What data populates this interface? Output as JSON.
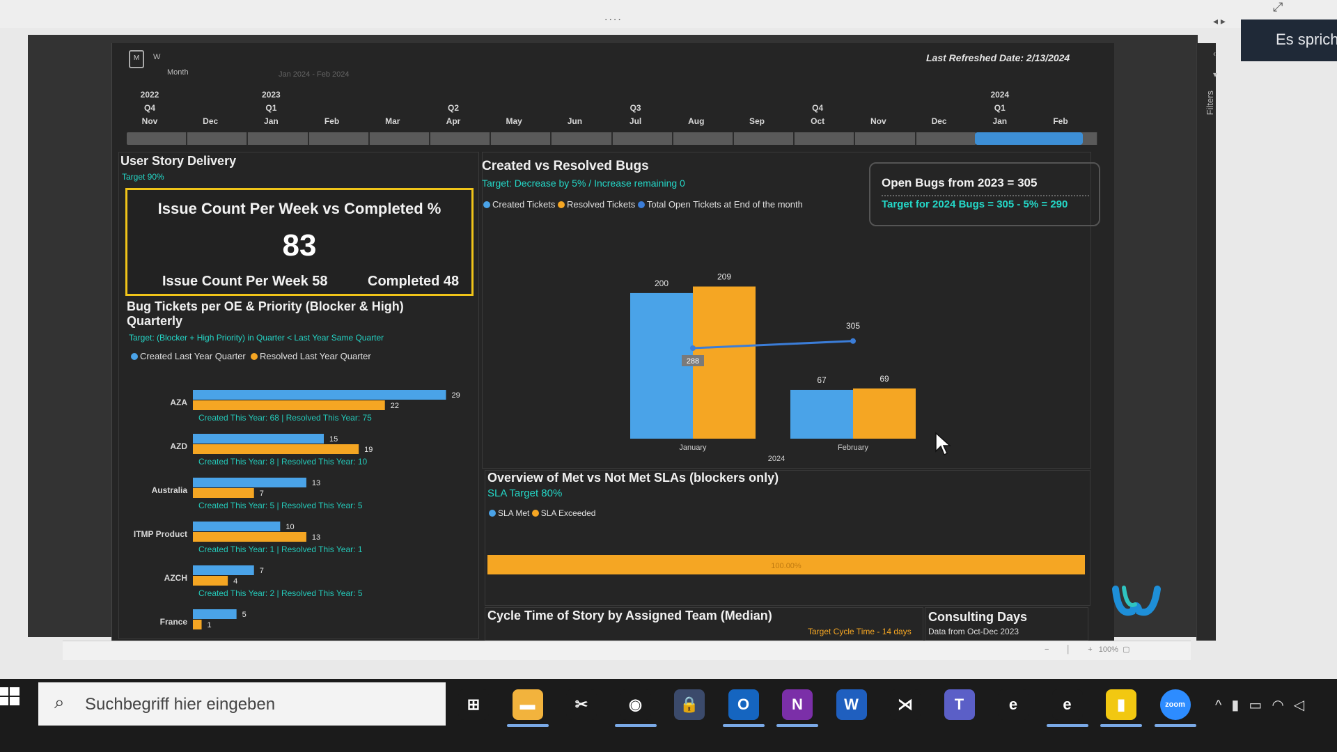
{
  "window": {
    "dots": "....",
    "speaking_text": "Es sprich"
  },
  "header": {
    "logo_letter": "M",
    "w_label": "W",
    "month_label": "Month",
    "range_label": "Jan 2024 - Feb 2024",
    "last_refreshed": "Last Refreshed Date: 2/13/2024"
  },
  "timeline": {
    "years": [
      {
        "label": "2022"
      },
      {
        "label": "2023"
      },
      {
        "label": "2024"
      }
    ],
    "quarters": [
      "Q4",
      "Q1",
      "Q2",
      "Q3",
      "Q4",
      "Q1"
    ],
    "months": [
      "Nov",
      "Dec",
      "Jan",
      "Feb",
      "Mar",
      "Apr",
      "May",
      "Jun",
      "Jul",
      "Aug",
      "Sep",
      "Oct",
      "Nov",
      "Dec",
      "Jan",
      "Feb"
    ],
    "selected_months": [
      "Jan",
      "Feb"
    ]
  },
  "story_delivery": {
    "title": "User Story Delivery",
    "target": "Target 90%",
    "card_title": "Issue Count Per Week vs Completed %",
    "value": "83",
    "left_label": "Issue Count Per Week 58",
    "right_label": "Completed 48"
  },
  "bug_tickets": {
    "title_line1": "Bug Tickets per OE & Priority (Blocker & High)",
    "title_line2": "Quarterly",
    "target": "Target: (Blocker + High Priority) in Quarter  < Last Year Same Quarter",
    "legend": [
      {
        "label": "Created Last Year Quarter",
        "color": "#4aa3e8"
      },
      {
        "label": "Resolved Last Year Quarter",
        "color": "#f5a623"
      }
    ]
  },
  "created_resolved": {
    "title": "Created vs Resolved Bugs",
    "target": "Target: Decrease by 5% / Increase remaining 0",
    "legend": [
      {
        "label": "Created Tickets",
        "color": "#4aa3e8"
      },
      {
        "label": "Resolved Tickets",
        "color": "#f5a623"
      },
      {
        "label": "Total Open Tickets at End of the month",
        "color": "#3b7dd8"
      }
    ],
    "open_bugs_line1": "Open Bugs from 2023 = 305",
    "open_bugs_line2": "Target for 2024 Bugs = 305 - 5% = 290"
  },
  "sla": {
    "title": "Overview  of Met vs Not Met SLAs  (blockers only)",
    "target": "SLA Target 80%",
    "legend": [
      {
        "label": "SLA Met",
        "color": "#4aa3e8"
      },
      {
        "label": "SLA Exceeded",
        "color": "#f5a623"
      }
    ],
    "bar_label": "100.00%"
  },
  "cycle_time": {
    "title": "Cycle Time of Story by Assigned Team (Median)",
    "target": "Target Cycle Time - 14 days"
  },
  "consulting": {
    "title": "Consulting Days",
    "subtitle": "Data from Oct-Dec 2023"
  },
  "footer": {
    "zoom": "100%"
  },
  "taskbar": {
    "search_placeholder": "Suchbegriff hier eingeben",
    "apps": [
      {
        "name": "task-view",
        "glyph": "⊞",
        "bg": "#1b1b1b"
      },
      {
        "name": "file-explorer",
        "glyph": "▬",
        "bg": "#f2b33d"
      },
      {
        "name": "snipping",
        "glyph": "✂",
        "bg": "#1b1b1b"
      },
      {
        "name": "chrome",
        "glyph": "◉",
        "bg": "#1b1b1b"
      },
      {
        "name": "keepass",
        "glyph": "🔒",
        "bg": "#3b4a6b"
      },
      {
        "name": "outlook",
        "glyph": "O",
        "bg": "#1565c0"
      },
      {
        "name": "onenote",
        "glyph": "N",
        "bg": "#7b2fa8"
      },
      {
        "name": "word",
        "glyph": "W",
        "bg": "#1f5fbf"
      },
      {
        "name": "vscode",
        "glyph": "⋊",
        "bg": "#1b1b1b"
      },
      {
        "name": "teams",
        "glyph": "T",
        "bg": "#5b5fc7"
      },
      {
        "name": "internet-explorer",
        "glyph": "e",
        "bg": "#1b1b1b"
      },
      {
        "name": "edge",
        "glyph": "e",
        "bg": "#1b1b1b"
      },
      {
        "name": "power-bi",
        "glyph": "▮",
        "bg": "#f2c811"
      },
      {
        "name": "zoom",
        "glyph": "zoom",
        "bg": "#2d8cff"
      }
    ]
  },
  "chart_data": [
    {
      "type": "bar",
      "orientation": "horizontal",
      "title": "Bug Tickets per OE & Priority (Blocker & High) Quarterly",
      "categories": [
        "AZA",
        "AZD",
        "Australia",
        "ITMP Product",
        "AZCH",
        "France"
      ],
      "series": [
        {
          "name": "Created Last Year Quarter",
          "color": "#4aa3e8",
          "values": [
            29,
            15,
            13,
            10,
            7,
            5
          ]
        },
        {
          "name": "Resolved Last Year Quarter",
          "color": "#f5a623",
          "values": [
            22,
            19,
            7,
            13,
            4,
            1
          ]
        }
      ],
      "annotations": [
        "Created This Year: 68 | Resolved This Year: 75",
        "Created This Year: 8 | Resolved This Year: 10",
        "Created This Year: 5 | Resolved This Year: 5",
        "Created This Year: 1 | Resolved This Year: 1",
        "Created This Year: 2 | Resolved This Year: 5",
        ""
      ],
      "xlim": [
        0,
        30
      ]
    },
    {
      "type": "bar",
      "title": "Created vs Resolved Bugs",
      "categories": [
        "January",
        "February"
      ],
      "x_group_label": "2024",
      "series": [
        {
          "name": "Created Tickets",
          "color": "#4aa3e8",
          "values": [
            200,
            67
          ]
        },
        {
          "name": "Resolved Tickets",
          "color": "#f5a623",
          "values": [
            209,
            69
          ]
        },
        {
          "name": "Total Open Tickets at End of the month",
          "color": "#3b7dd8",
          "type": "line",
          "values": [
            288,
            305
          ]
        }
      ],
      "ylim": [
        0,
        220
      ]
    },
    {
      "type": "bar",
      "orientation": "horizontal",
      "stacked": true,
      "title": "Overview of Met vs Not Met SLAs (blockers only)",
      "series": [
        {
          "name": "SLA Met",
          "color": "#4aa3e8",
          "values": [
            0
          ]
        },
        {
          "name": "SLA Exceeded",
          "color": "#f5a623",
          "values": [
            100
          ]
        }
      ],
      "value_label": "100.00%"
    }
  ]
}
